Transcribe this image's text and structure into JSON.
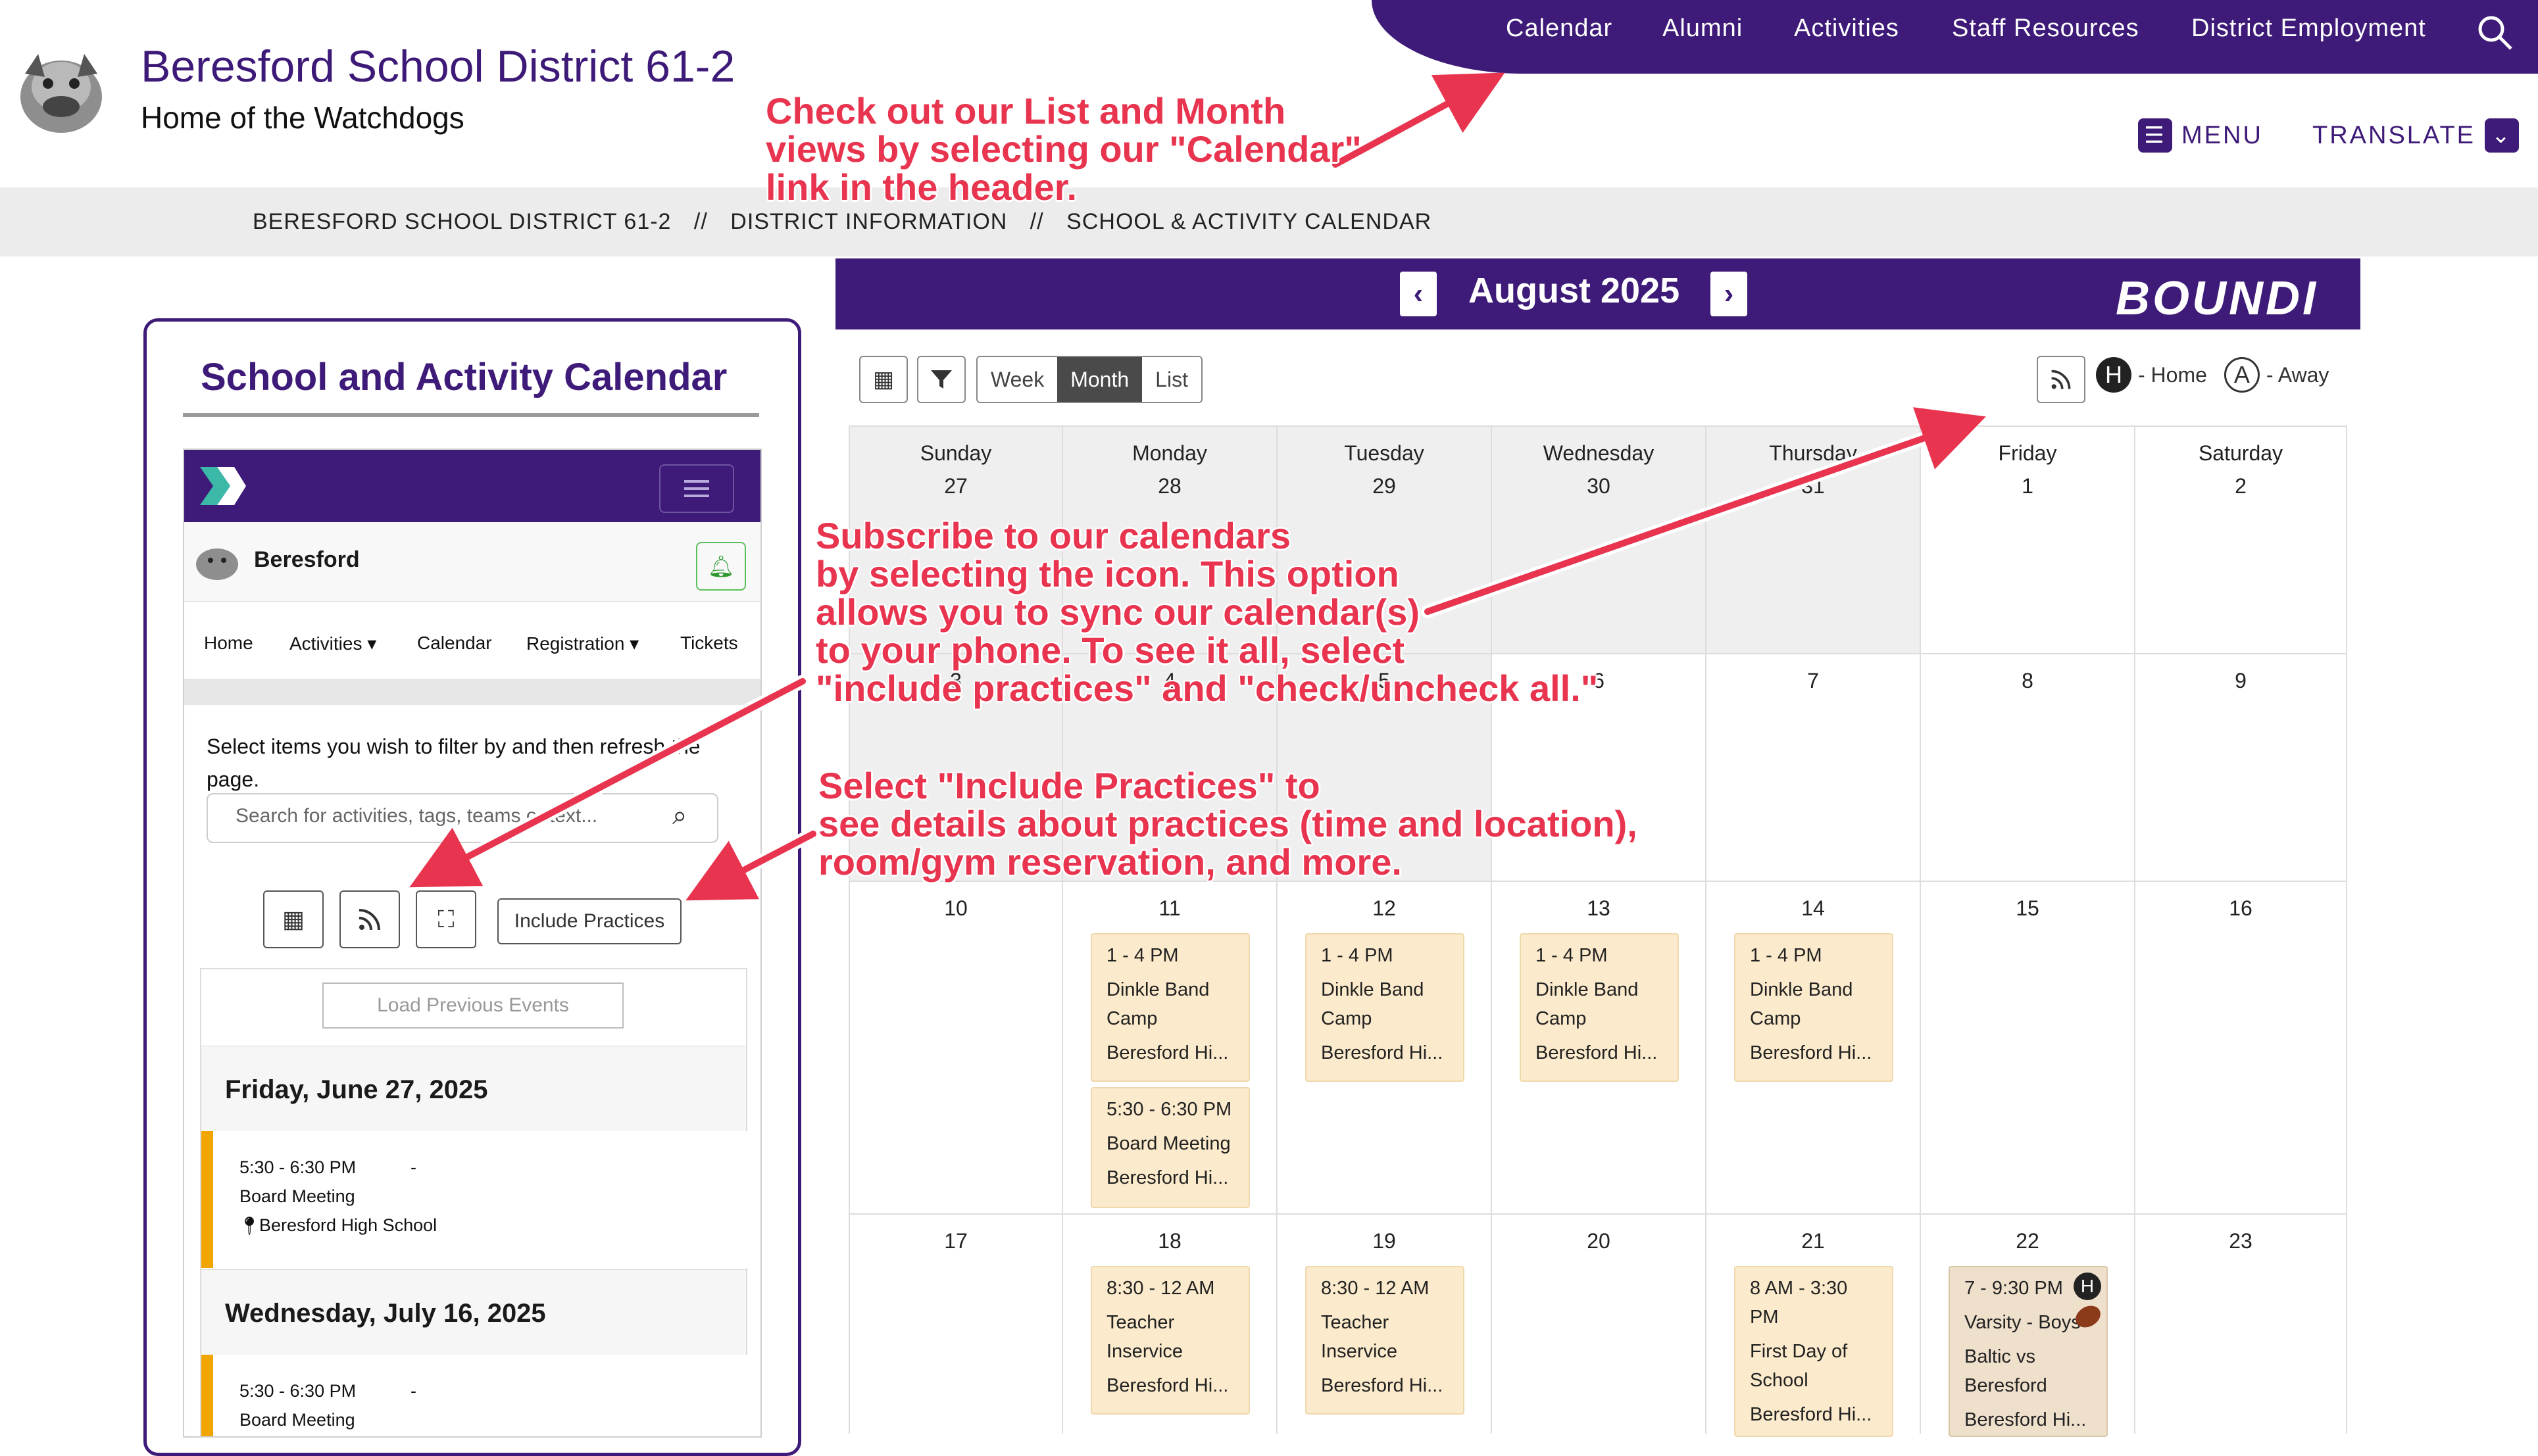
{
  "header": {
    "title": "Beresford School District 61-2",
    "subtitle": "Home of the Watchdogs",
    "nav": [
      "Calendar",
      "Alumni",
      "Activities",
      "Staff Resources",
      "District Employment"
    ],
    "menu_label": "MENU",
    "translate_label": "TRANSLATE"
  },
  "breadcrumb": {
    "items": [
      "BERESFORD SCHOOL DISTRICT 61-2",
      "//",
      "DISTRICT INFORMATION",
      "//",
      "SCHOOL & ACTIVITY CALENDAR"
    ]
  },
  "left": {
    "title": "School and Activity Calendar",
    "school_name": "Beresford",
    "nav": [
      "Home",
      "Activities ▾",
      "Calendar",
      "Registration ▾",
      "Tickets"
    ],
    "filter_text": "Select items you wish to filter by and then refresh the page.",
    "search_placeholder": "Search for activities, tags, teams or text...",
    "include_practices": "Include Practices",
    "load_previous": "Load Previous Events",
    "days": [
      {
        "date": "Friday, June 27, 2025",
        "time": "5:30 - 6:30 PM",
        "dash": "-",
        "name": "Board Meeting",
        "location": "Beresford High School"
      },
      {
        "date": "Wednesday, July 16, 2025",
        "time": "5:30 - 6:30 PM",
        "dash": "-",
        "name": "Board Meeting"
      }
    ]
  },
  "calendar": {
    "month": "August 2025",
    "brand": "BOUNDI",
    "views": [
      "Week",
      "Month",
      "List"
    ],
    "active_view": "Month",
    "legend_home": "- Home",
    "legend_away": "- Away",
    "home_letter": "H",
    "away_letter": "A",
    "days_of_week": [
      "Sunday",
      "Monday",
      "Tuesday",
      "Wednesday",
      "Thursday",
      "Friday",
      "Saturday"
    ],
    "week1": [
      "27",
      "28",
      "29",
      "30",
      "31",
      "1",
      "2"
    ],
    "week2": [
      "3",
      "4",
      "5",
      "6",
      "7",
      "8",
      "9"
    ],
    "week3": [
      "10",
      "11",
      "12",
      "13",
      "14",
      "15",
      "16"
    ],
    "week4": [
      "17",
      "18",
      "19",
      "20",
      "21",
      "22",
      "23"
    ],
    "events": {
      "band": {
        "time": "1 - 4 PM",
        "name1": "Dinkle Band",
        "name2": "Camp",
        "loc": "Beresford Hi..."
      },
      "board": {
        "time": "5:30 - 6:30 PM",
        "name": "Board Meeting",
        "loc": "Beresford Hi..."
      },
      "inservice": {
        "time": "8:30 - 12 AM",
        "name1": "Teacher",
        "name2": "Inservice",
        "loc": "Beresford Hi..."
      },
      "firstday": {
        "time1": "8 AM - 3:30",
        "time2": "PM",
        "name1": "First Day of",
        "name2": "School",
        "loc": "Beresford Hi..."
      },
      "football": {
        "time": "7 - 9:30 PM",
        "name": "Varsity - Boys",
        "opp1": "Baltic vs",
        "opp2": "Beresford",
        "loc": "Beresford Hi..."
      }
    }
  },
  "annotations": {
    "calendar_note": [
      "Check out our List and Month",
      "views by selecting our \"Calendar\"",
      "link in the header."
    ],
    "subscribe_note": [
      "Subscribe to our calendars",
      "by selecting the icon. This option",
      "allows you to sync our calendar(s)",
      "to your phone. To see it all, select",
      "\"include practices\" and \"check/uncheck all.\""
    ],
    "practices_note": [
      "Select \"Include Practices\" to",
      "see details about practices (time and location),",
      "room/gym reservation, and more."
    ],
    "accent_color": "#e8344e"
  },
  "colors": {
    "brand_purple": "#3e1b78",
    "event_bg": "#fbeacb",
    "event_stripe": "#f0a500"
  }
}
